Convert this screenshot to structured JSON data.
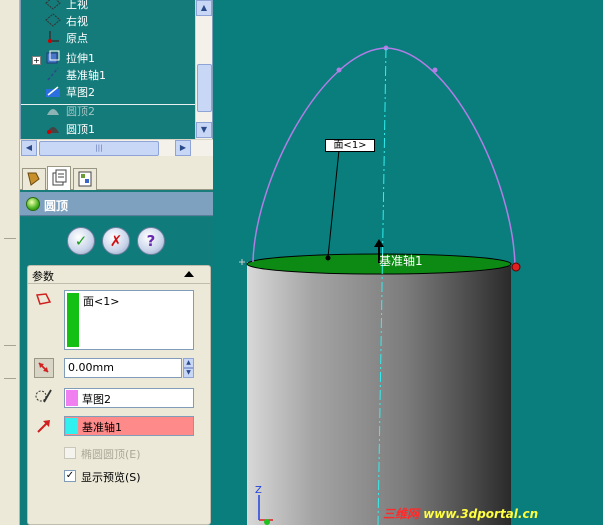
{
  "tree": {
    "items": [
      {
        "label": "上视",
        "icon": "plane-icon"
      },
      {
        "label": "右视",
        "icon": "plane-icon"
      },
      {
        "label": "原点",
        "icon": "origin-icon"
      },
      {
        "label": "拉伸1",
        "icon": "extrude-icon"
      },
      {
        "label": "基准轴1",
        "icon": "axis-icon"
      },
      {
        "label": "草图2",
        "icon": "sketch-icon"
      },
      {
        "label": "圆顶2",
        "icon": "dome-icon"
      },
      {
        "label": "圆顶1",
        "icon": "dome-icon"
      }
    ],
    "hscroll_grip": "|||"
  },
  "property_manager": {
    "title": "圆顶",
    "ok_symbol": "✓",
    "cancel_symbol": "✗",
    "help_symbol": "?",
    "group_title": "参数",
    "face_selection": "面<1>",
    "distance_value": "0.00mm",
    "sketch_field": "草图2",
    "axis_field": "基准轴1",
    "elliptical_label": "椭圆圆顶(E)",
    "elliptical_checked": false,
    "preview_label": "显示预览(S)",
    "preview_checked": true,
    "check_mark": "✓"
  },
  "viewport": {
    "callout_label": "面<1>",
    "axis_label": "基准轴1",
    "triad_z": "Z",
    "watermark_a": "三维网",
    "watermark_b": "www.3dportal.cn"
  },
  "colors": {
    "background": "#0a7d7d",
    "selection_green": "#14c014",
    "dome_preview": "#b27de6",
    "axis_pink": "#ff8a8a",
    "sketch_magenta": "#f080f0",
    "axis_cyan": "#30f0f0"
  }
}
